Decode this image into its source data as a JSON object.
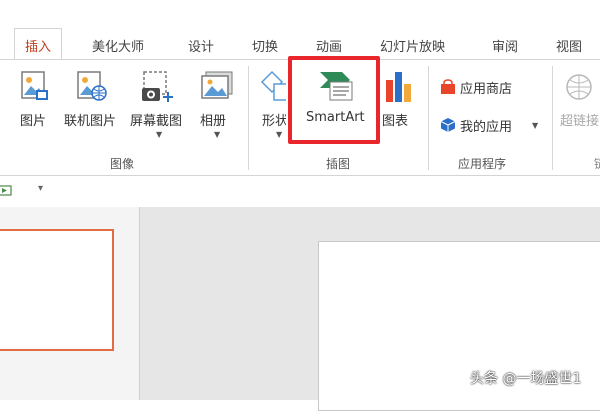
{
  "tabs": [
    {
      "label": "插入",
      "active": true
    },
    {
      "label": "美化大师"
    },
    {
      "label": "设计"
    },
    {
      "label": "切换"
    },
    {
      "label": "动画"
    },
    {
      "label": "幻灯片放映"
    },
    {
      "label": "审阅"
    },
    {
      "label": "视图"
    }
  ],
  "ribbon": {
    "images_group": {
      "label": "图像",
      "buttons": [
        "图片",
        "联机图片",
        "屏幕截图",
        "相册"
      ]
    },
    "illustrations_group": {
      "label": "插图",
      "buttons": [
        "形状",
        "SmartArt",
        "图表"
      ]
    },
    "apps_group": {
      "label": "应用程序",
      "buttons": [
        "应用商店",
        "我的应用"
      ]
    },
    "links_group": {
      "buttons": [
        "超链接"
      ],
      "label_partial": "链"
    }
  },
  "watermark": "头条 @一场盛世1",
  "colors": {
    "accent": "#c43e1c",
    "highlight": "#e8262b",
    "thumbnail_border": "#e46c43",
    "smartart_green": "#2e8b57",
    "store_red": "#e8452c",
    "myapps_blue": "#2a6fc9"
  }
}
